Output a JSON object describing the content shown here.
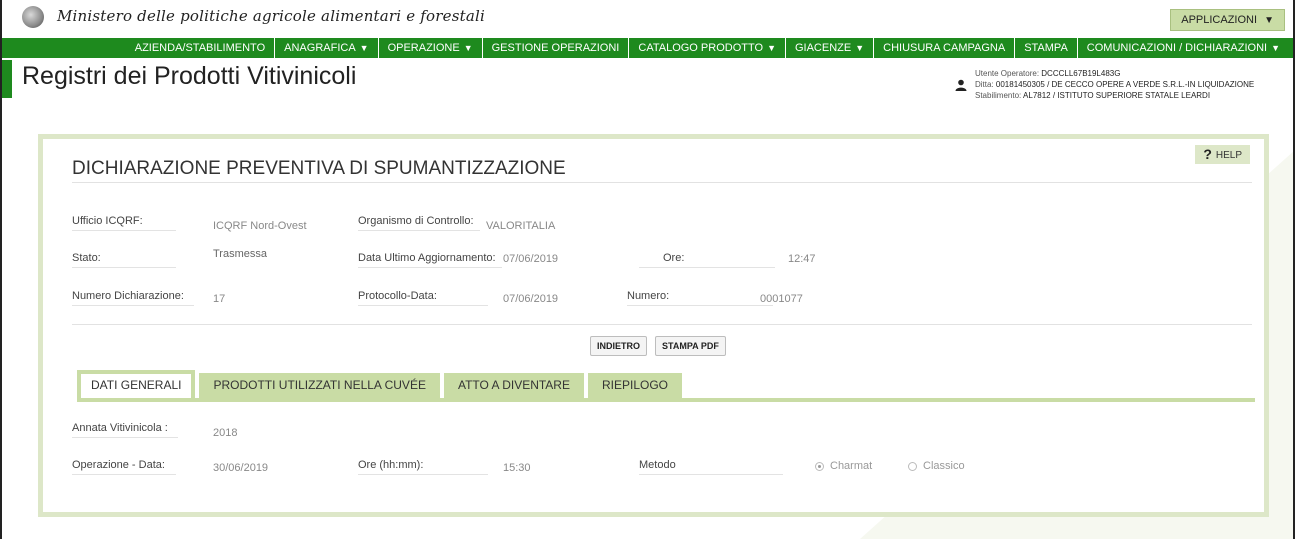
{
  "header": {
    "ministry": "Ministero delle politiche agricole alimentari e forestali",
    "applications_label": "APPLICAZIONI",
    "page_title": "Registri dei Prodotti Vitivinicoli"
  },
  "nav": {
    "items": [
      {
        "label": "AZIENDA/STABILIMENTO",
        "dropdown": false
      },
      {
        "label": "ANAGRAFICA",
        "dropdown": true
      },
      {
        "label": "OPERAZIONE",
        "dropdown": true
      },
      {
        "label": "GESTIONE OPERAZIONI",
        "dropdown": false
      },
      {
        "label": "CATALOGO PRODOTTO",
        "dropdown": true
      },
      {
        "label": "GIACENZE",
        "dropdown": true
      },
      {
        "label": "CHIUSURA CAMPAGNA",
        "dropdown": false
      },
      {
        "label": "STAMPA",
        "dropdown": false
      },
      {
        "label": "COMUNICAZIONI / DICHIARAZIONI",
        "dropdown": true
      }
    ],
    "caret": "▼"
  },
  "user": {
    "operator_label": "Utente Operatore:",
    "operator_value": "DCCCLL67B19L483G",
    "ditta_label": "Ditta:",
    "ditta_value": "00181450305 / DE CECCO OPERE A VERDE S.R.L.-IN LIQUIDAZIONE",
    "stabilimento_label": "Stabilimento:",
    "stabilimento_value": "AL7812 / ISTITUTO SUPERIORE STATALE LEARDI"
  },
  "panel": {
    "help_label": "HELP",
    "help_icon": "?",
    "title": "DICHIARAZIONE PREVENTIVA DI SPUMANTIZZAZIONE",
    "fields": {
      "ufficio_label": "Ufficio ICQRF:",
      "ufficio_value": "ICQRF Nord-Ovest",
      "organismo_label": "Organismo di Controllo:",
      "organismo_value": "VALORITALIA",
      "stato_label": "Stato:",
      "stato_value": "Trasmessa",
      "data_agg_label": "Data Ultimo Aggiornamento:",
      "data_agg_value": "07/06/2019",
      "ore_label": "Ore:",
      "ore_value": "12:47",
      "numero_dich_label": "Numero Dichiarazione:",
      "numero_dich_value": "17",
      "protocollo_label": "Protocollo-Data:",
      "protocollo_value": "07/06/2019",
      "numero_label": "Numero:",
      "numero_value": "0001077"
    },
    "buttons": {
      "back": "INDIETRO",
      "print": "STAMPA PDF"
    },
    "tabs": [
      {
        "label": "DATI GENERALI",
        "active": true
      },
      {
        "label": "PRODOTTI UTILIZZATI NELLA CUVÉE",
        "active": false
      },
      {
        "label": "ATTO A DIVENTARE",
        "active": false
      },
      {
        "label": "RIEPILOGO",
        "active": false
      }
    ],
    "general": {
      "annata_label": "Annata Vitivinicola :",
      "annata_value": "2018",
      "operazione_label": "Operazione - Data:",
      "operazione_value": "30/06/2019",
      "ore_label": "Ore (hh:mm):",
      "ore_value": "15:30",
      "metodo_label": "Metodo",
      "metodo_options": [
        "Charmat",
        "Classico"
      ],
      "metodo_selected": "Charmat"
    }
  },
  "colors": {
    "nav_green": "#1e8a1e",
    "panel_border": "#dde7c8",
    "tab_green": "#c9dca5"
  }
}
